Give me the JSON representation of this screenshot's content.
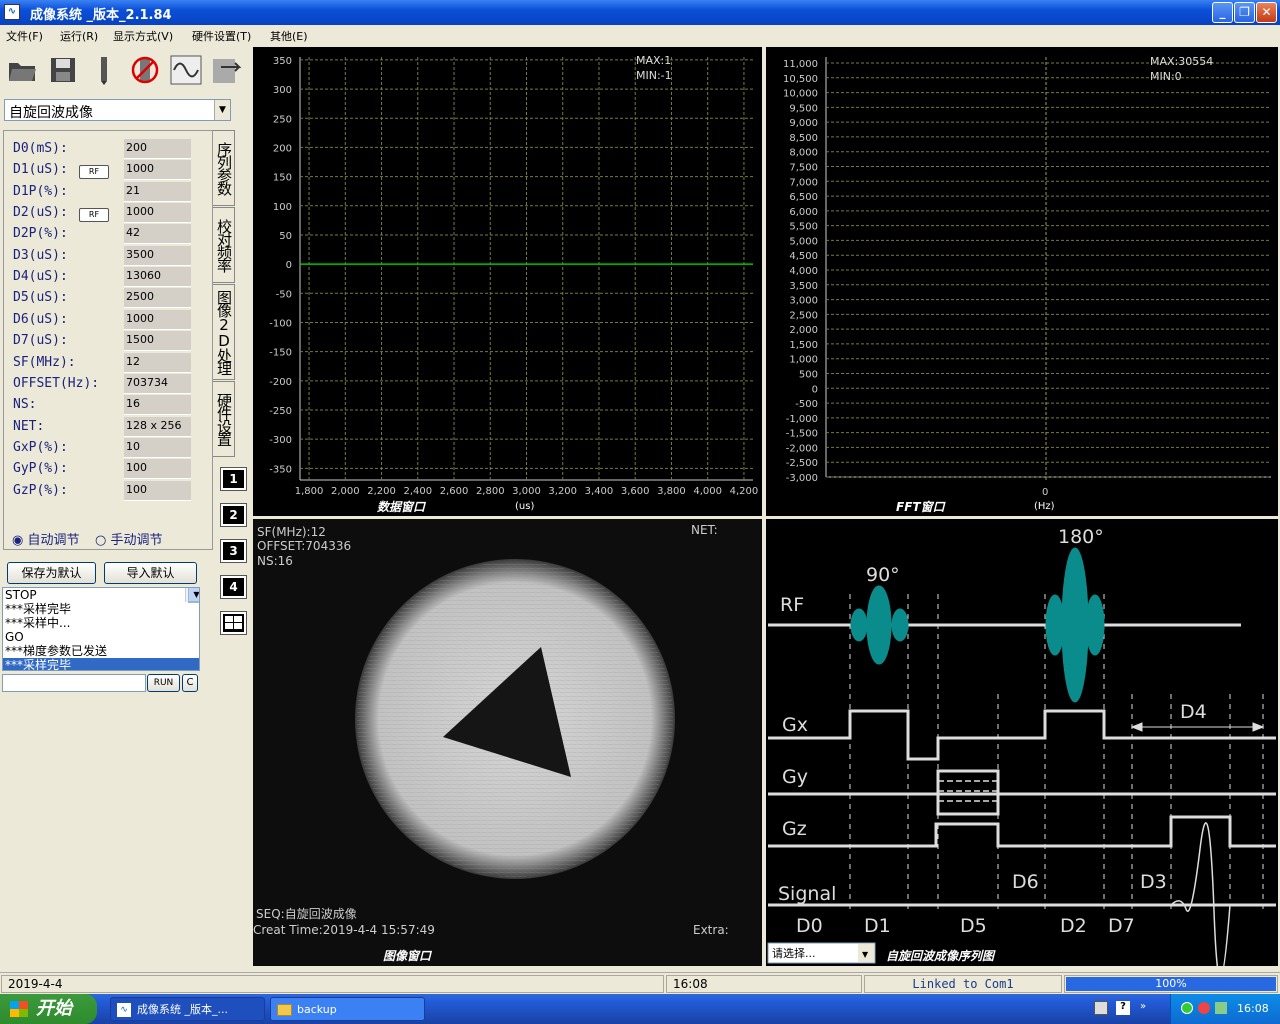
{
  "window": {
    "title": "成像系统 _版本_2.1.84",
    "icon": "waveform-icon",
    "minimize": "_",
    "maximize": "❐",
    "close": "✕"
  },
  "menu": [
    "文件(F)",
    "运行(R)",
    "显示方式(V)",
    "硬件设置(T)",
    "其他(E)"
  ],
  "toolbar": [
    "open-folder-icon",
    "save-disk-icon",
    "pen-icon",
    "no-hardware-icon",
    "waveform-icon",
    "export-data-icon"
  ],
  "sequence_select": "自旋回波成像",
  "params": [
    {
      "label": "D0(mS):",
      "value": "200",
      "rf": false
    },
    {
      "label": "D1(uS):",
      "value": "1000",
      "rf": true
    },
    {
      "label": "D1P(%):",
      "value": "21",
      "rf": false
    },
    {
      "label": "D2(uS):",
      "value": "1000",
      "rf": true
    },
    {
      "label": "D2P(%):",
      "value": "42",
      "rf": false
    },
    {
      "label": "D3(uS):",
      "value": "3500",
      "rf": false
    },
    {
      "label": "D4(uS):",
      "value": "13060",
      "rf": false
    },
    {
      "label": "D5(uS):",
      "value": "2500",
      "rf": false
    },
    {
      "label": "D6(uS):",
      "value": "1000",
      "rf": false
    },
    {
      "label": "D7(uS):",
      "value": "1500",
      "rf": false
    },
    {
      "label": "SF(MHz):",
      "value": "12",
      "rf": false
    },
    {
      "label": "OFFSET(Hz):",
      "value": "703734",
      "rf": false
    },
    {
      "label": "NS:",
      "value": "16",
      "rf": false
    },
    {
      "label": "NET:",
      "value": "128 x 256",
      "rf": false
    },
    {
      "label": "GxP(%):",
      "value": "10",
      "rf": false
    },
    {
      "label": "GyP(%):",
      "value": "100",
      "rf": false
    },
    {
      "label": "GzP(%):",
      "value": "100",
      "rf": false
    }
  ],
  "rf_label": "RF",
  "side_tabs": [
    "序列参数",
    "校对频率",
    "图像2D处理",
    "硬件设置"
  ],
  "view_buttons": [
    "1",
    "2",
    "3",
    "4"
  ],
  "radios": {
    "auto": "自动调节",
    "manual": "手动调节",
    "selected": "auto"
  },
  "buttons": {
    "save_default": "保存为默认",
    "import_default": "导入默认",
    "run": "RUN",
    "clear": "C"
  },
  "log": [
    "STOP",
    "***采样完毕",
    "***采样中...",
    "GO",
    "***梯度参数已发送",
    "***采样完毕"
  ],
  "data_window": {
    "caption": "数据窗口",
    "x_unit": "(us)",
    "max_text": "MAX:1",
    "min_text": "MIN:-1",
    "chart_data": {
      "type": "line",
      "x_ticks": [
        "1,800",
        "2,000",
        "2,200",
        "2,400",
        "2,600",
        "2,800",
        "3,000",
        "3,200",
        "3,400",
        "3,600",
        "3,800",
        "4,000",
        "4,200"
      ],
      "y_ticks": [
        "350",
        "300",
        "250",
        "200",
        "150",
        "100",
        "50",
        "0",
        "-50",
        "-100",
        "-150",
        "-200",
        "-250",
        "-300",
        "-350"
      ],
      "xlim": [
        1750,
        4250
      ],
      "ylim": [
        -370,
        355
      ],
      "series": [
        {
          "color": "#00c000",
          "x": [
            1750,
            4250
          ],
          "y": [
            0,
            0
          ]
        }
      ],
      "grid": true
    }
  },
  "fft_window": {
    "caption": "FFT窗口",
    "x_unit": "(Hz)",
    "max_text": "MAX:30554",
    "min_text": "MIN:0",
    "chart_data": {
      "type": "line",
      "x_ticks": [
        "0"
      ],
      "y_ticks": [
        "11,000",
        "10,500",
        "10,000",
        "9,500",
        "9,000",
        "8,500",
        "8,000",
        "7,500",
        "7,000",
        "6,500",
        "6,000",
        "5,500",
        "5,000",
        "4,500",
        "4,000",
        "3,500",
        "3,000",
        "2,500",
        "2,000",
        "1,500",
        "1,000",
        "500",
        "0",
        "-500",
        "-1,000",
        "-1,500",
        "-2,000",
        "-2,500",
        "-3,000"
      ],
      "ylim": [
        -3000,
        11000
      ],
      "grid": true
    }
  },
  "image_window": {
    "caption": "图像窗口",
    "sf": "SF(MHz):12",
    "offset": "OFFSET:704336",
    "ns": "NS:16",
    "net": "NET:",
    "seq": "SEQ:自旋回波成像",
    "created": "Creat Time:2019-4-4  15:57:49",
    "extra": "Extra:"
  },
  "seq_diagram": {
    "caption": "自旋回波成像序列图",
    "select": "请选择...",
    "rows": [
      "RF",
      "Gx",
      "Gy",
      "Gz",
      "Signal"
    ],
    "pulse90": "90°",
    "pulse180": "180°",
    "d4": "D4",
    "d6": "D6",
    "d3": "D3",
    "bottom_labels": [
      "D0",
      "D1",
      "D5",
      "D2",
      "D7"
    ]
  },
  "status": {
    "date": "2019-4-4",
    "time": "16:08",
    "link": "Linked to Com1",
    "progress_text": "100%",
    "progress": 1.0
  },
  "taskbar": {
    "start": "开始",
    "tasks": [
      "成像系统 _版本_...",
      "backup"
    ],
    "clock": "16:08"
  }
}
